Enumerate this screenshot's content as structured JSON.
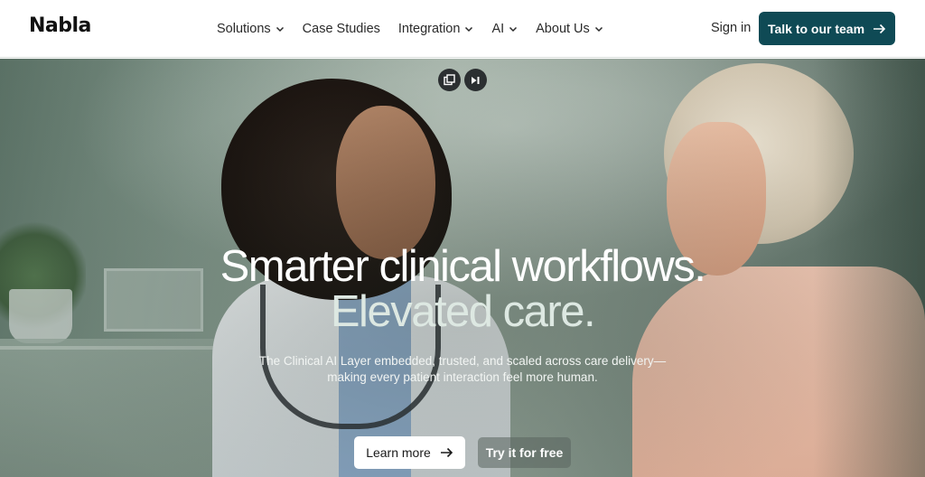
{
  "header": {
    "logo": "Nabla",
    "nav": [
      {
        "label": "Solutions",
        "dropdown": true
      },
      {
        "label": "Case Studies",
        "dropdown": false
      },
      {
        "label": "Integration",
        "dropdown": true
      },
      {
        "label": "AI",
        "dropdown": true
      },
      {
        "label": "About Us",
        "dropdown": true
      }
    ],
    "sign_in": "Sign in",
    "cta": "Talk to our team"
  },
  "hero": {
    "media_controls": [
      "picture-in-picture-icon",
      "skip-forward-icon"
    ],
    "headline_line1": "Smarter clinical workflows.",
    "headline_line2": "Elevated care.",
    "subtext_line1": "The Clinical AI Layer embedded, trusted, and scaled across care delivery—",
    "subtext_line2": "making every patient interaction feel more human.",
    "primary_button": "Learn more",
    "secondary_button": "Try it for free"
  },
  "colors": {
    "cta_background": "#0f4a55",
    "header_background": "#ffffff"
  }
}
